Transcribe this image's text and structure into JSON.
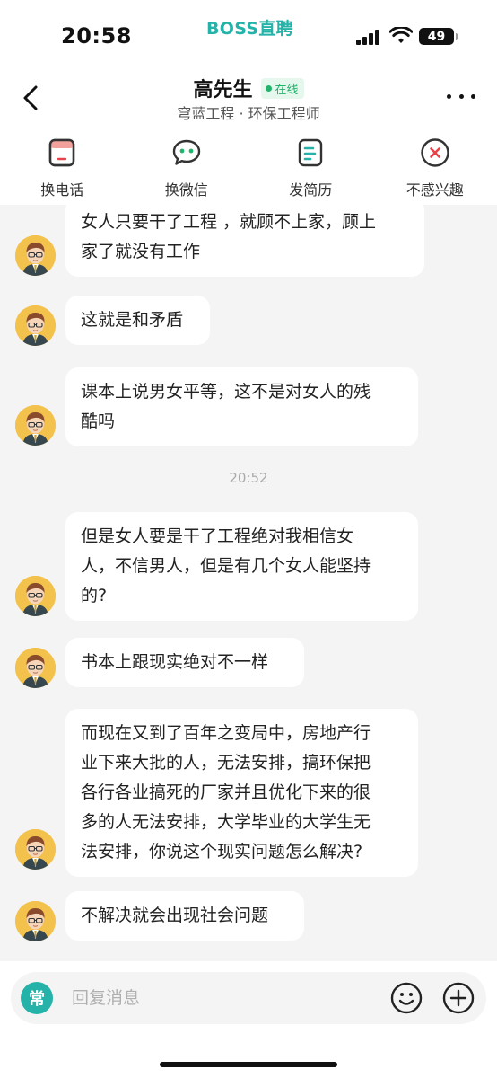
{
  "status_bar": {
    "time": "20:58",
    "brand": "BOSS直聘",
    "battery": "49"
  },
  "header": {
    "name": "高先生",
    "online_label": "在线",
    "company_line": "穹蓝工程 · 环保工程师"
  },
  "actions": [
    {
      "label": "换电话",
      "icon": "phone-icon"
    },
    {
      "label": "换微信",
      "icon": "wechat-icon"
    },
    {
      "label": "发简历",
      "icon": "resume-icon"
    },
    {
      "label": "不感兴趣",
      "icon": "not-interested-icon"
    }
  ],
  "messages": [
    {
      "lines": [
        "女人只要干了工程 ，就顾不上家，顾上",
        "家了就没有工作"
      ]
    },
    {
      "lines": [
        "这就是和矛盾"
      ]
    },
    {
      "lines": [
        "课本上说男女平等，这不是对女人的残",
        "酷吗"
      ]
    },
    {
      "lines": [
        "但是女人要是干了工程绝对我相信女",
        "人，不信男人，但是有几个女人能坚持",
        "的?"
      ]
    },
    {
      "lines": [
        "书本上跟现实绝对不一样"
      ]
    },
    {
      "lines": [
        "而现在又到了百年之变局中，房地产行",
        "业下来大批的人，无法安排，搞环保把",
        "各行各业搞死的厂家并且优化下来的很",
        "多的人无法安排，大学毕业的大学生无",
        "法安排，你说这个现实问题怎么解决?"
      ]
    },
    {
      "lines": [
        "不解决就会出现社会问题"
      ]
    }
  ],
  "timestamp": "20:52",
  "input": {
    "common_label": "常",
    "placeholder": "回复消息"
  },
  "colors": {
    "brand_teal": "#25b3a9",
    "online_green": "#21b26b",
    "reject_red": "#e8434a"
  }
}
